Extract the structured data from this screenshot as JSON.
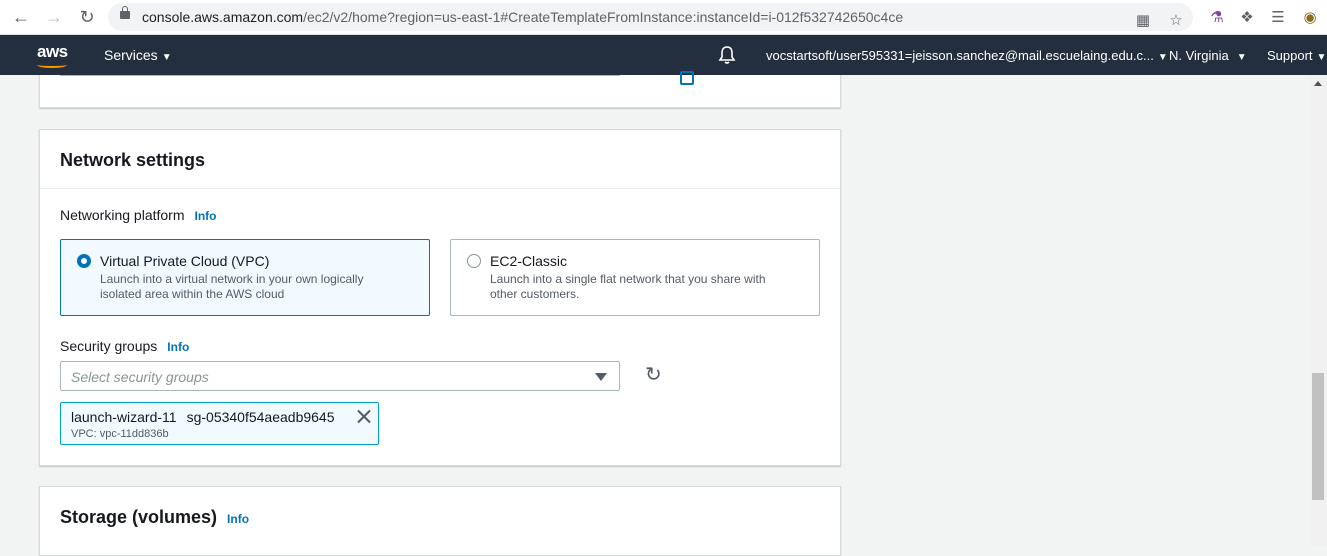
{
  "browser": {
    "url_host": "console.aws.amazon.com",
    "url_path": "/ec2/v2/home?region=us-east-1#CreateTemplateFromInstance:instanceId=i-012f532742650c4ce"
  },
  "header": {
    "logo": "aws",
    "services": "Services",
    "account": "vocstartsoft/user595331=jeisson.sanchez@mail.escuelaing.edu.c...",
    "region": "N. Virginia",
    "support": "Support"
  },
  "network": {
    "title": "Network settings",
    "platform_label": "Networking platform",
    "info": "Info",
    "options": [
      {
        "title": "Virtual Private Cloud (VPC)",
        "desc": "Launch into a virtual network in your own logically isolated area within the AWS cloud",
        "selected": true
      },
      {
        "title": "EC2-Classic",
        "desc": "Launch into a single flat network that you share with other customers.",
        "selected": false
      }
    ],
    "sg_label": "Security groups",
    "sg_placeholder": "Select security groups",
    "token": {
      "name": "launch-wizard-11",
      "id": "sg-05340f54aeadb9645",
      "vpc": "VPC: vpc-11dd836b"
    }
  },
  "storage": {
    "title": "Storage (volumes)",
    "info": "Info"
  },
  "colors": {
    "accent": "#0073bb",
    "header_bg": "#232f3e",
    "brand": "#ff9900"
  }
}
